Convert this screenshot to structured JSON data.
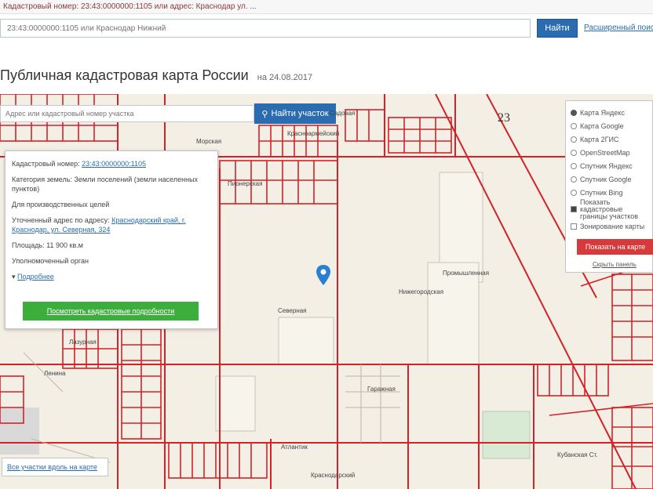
{
  "top_strip": {
    "text": "Кадастровый номер: 23:43:0000000:1105 или адрес: Краснодар ул. ..."
  },
  "search": {
    "placeholder": "23:43:0000000:1105 или Краснодар Нижний",
    "find_label": "Найти",
    "advanced_label": "Расширенный поиск"
  },
  "page": {
    "title": "Публичная кадастровая карта России",
    "date": "на 24.08.2017"
  },
  "map": {
    "search_placeholder": "Адрес или кадастровый номер участка",
    "find_label": "Найти участок",
    "zone_number": "23",
    "bottom_link": "Все участки вдоль на карте",
    "labels": [
      {
        "text": "Красноармейский",
        "name": "street-label-krasnoarmeysky"
      },
      {
        "text": "Краснодарский",
        "name": "street-label-krasnodarsky"
      },
      {
        "text": "Кубанская Ст.",
        "name": "street-label-kubanskaya"
      },
      {
        "text": "Нижегородская",
        "name": "street-label-nizhegorodskaya"
      },
      {
        "text": "Северная",
        "name": "street-label-severnaya"
      },
      {
        "text": "Атлантик",
        "name": "street-label-atlantik"
      },
      {
        "text": "Лазурная",
        "name": "street-label-lazurnaya"
      },
      {
        "text": "Гаражная",
        "name": "street-label-garazhnaya"
      },
      {
        "text": "Промышленная",
        "name": "street-label-promyshlennaya"
      },
      {
        "text": "Ленина",
        "name": "street-label-lenina"
      },
      {
        "text": "Пионерская",
        "name": "street-label-pionerskaya"
      },
      {
        "text": "Морская",
        "name": "street-label-morskaya"
      },
      {
        "text": "Садовая",
        "name": "street-label-sadovaya"
      }
    ]
  },
  "popup": {
    "cadastral_label": "Кадастровый номер:",
    "cadastral_value": "23:43:0000000:1105",
    "category": "Категория земель: Земли поселений (земли населенных пунктов)",
    "usage": "Для производственных целей",
    "address_label": "Уточненный адрес по адресу:",
    "address_value": "Краснодарский край, г. Краснодар, ул. Северная, 324",
    "area": "Площадь: 11 900 кв.м",
    "owner": "Уполномоченный орган",
    "more_label": "Подробнее",
    "button_label": "Посмотреть кадастровые подробности"
  },
  "layers": {
    "options": [
      {
        "label": "Карта Яндекс",
        "selected": true
      },
      {
        "label": "Карта Google",
        "selected": false
      },
      {
        "label": "Карта 2ГИС",
        "selected": false
      },
      {
        "label": "OpenStreetMap",
        "selected": false
      },
      {
        "label": "Спутник Яндекс",
        "selected": false
      },
      {
        "label": "Спутник Google",
        "selected": false
      },
      {
        "label": "Спутник Bing",
        "selected": false
      }
    ],
    "check1": "Показать кадастровые границы участков",
    "check2": "Зонирование карты",
    "button_label": "Показать на карте",
    "footer_link": "Скрыть панель"
  },
  "colors": {
    "parcel_border": "#d2222a",
    "map_background": "#f3efe4",
    "accent_blue": "#2b6cb0",
    "button_green": "#3cae3c",
    "button_red": "#d63b3b",
    "pin": "#2a7fd4"
  }
}
